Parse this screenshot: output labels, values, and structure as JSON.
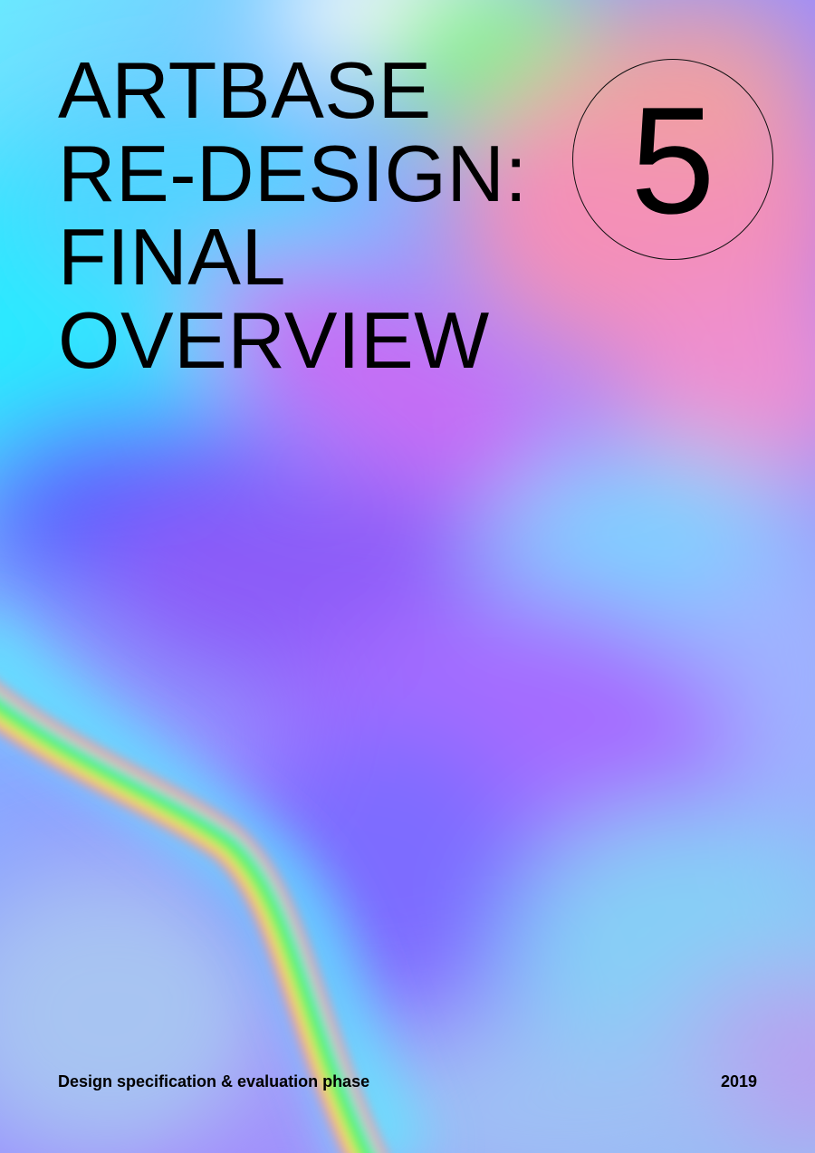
{
  "cover": {
    "title_lines": [
      "ARTBASE",
      "RE-DESIGN:",
      "FINAL",
      "OVERVIEW"
    ],
    "issue_number": "5",
    "subtitle": "Design specification & evaluation phase",
    "year": "2019"
  },
  "colors": {
    "text": "#000000",
    "gradient_cyan": "#22e8ff",
    "gradient_blue": "#5a7cff",
    "gradient_violet": "#a86cff",
    "gradient_pink": "#f08ac0",
    "gradient_green": "#6af06a",
    "gradient_lightblue": "#8fc8f5"
  }
}
